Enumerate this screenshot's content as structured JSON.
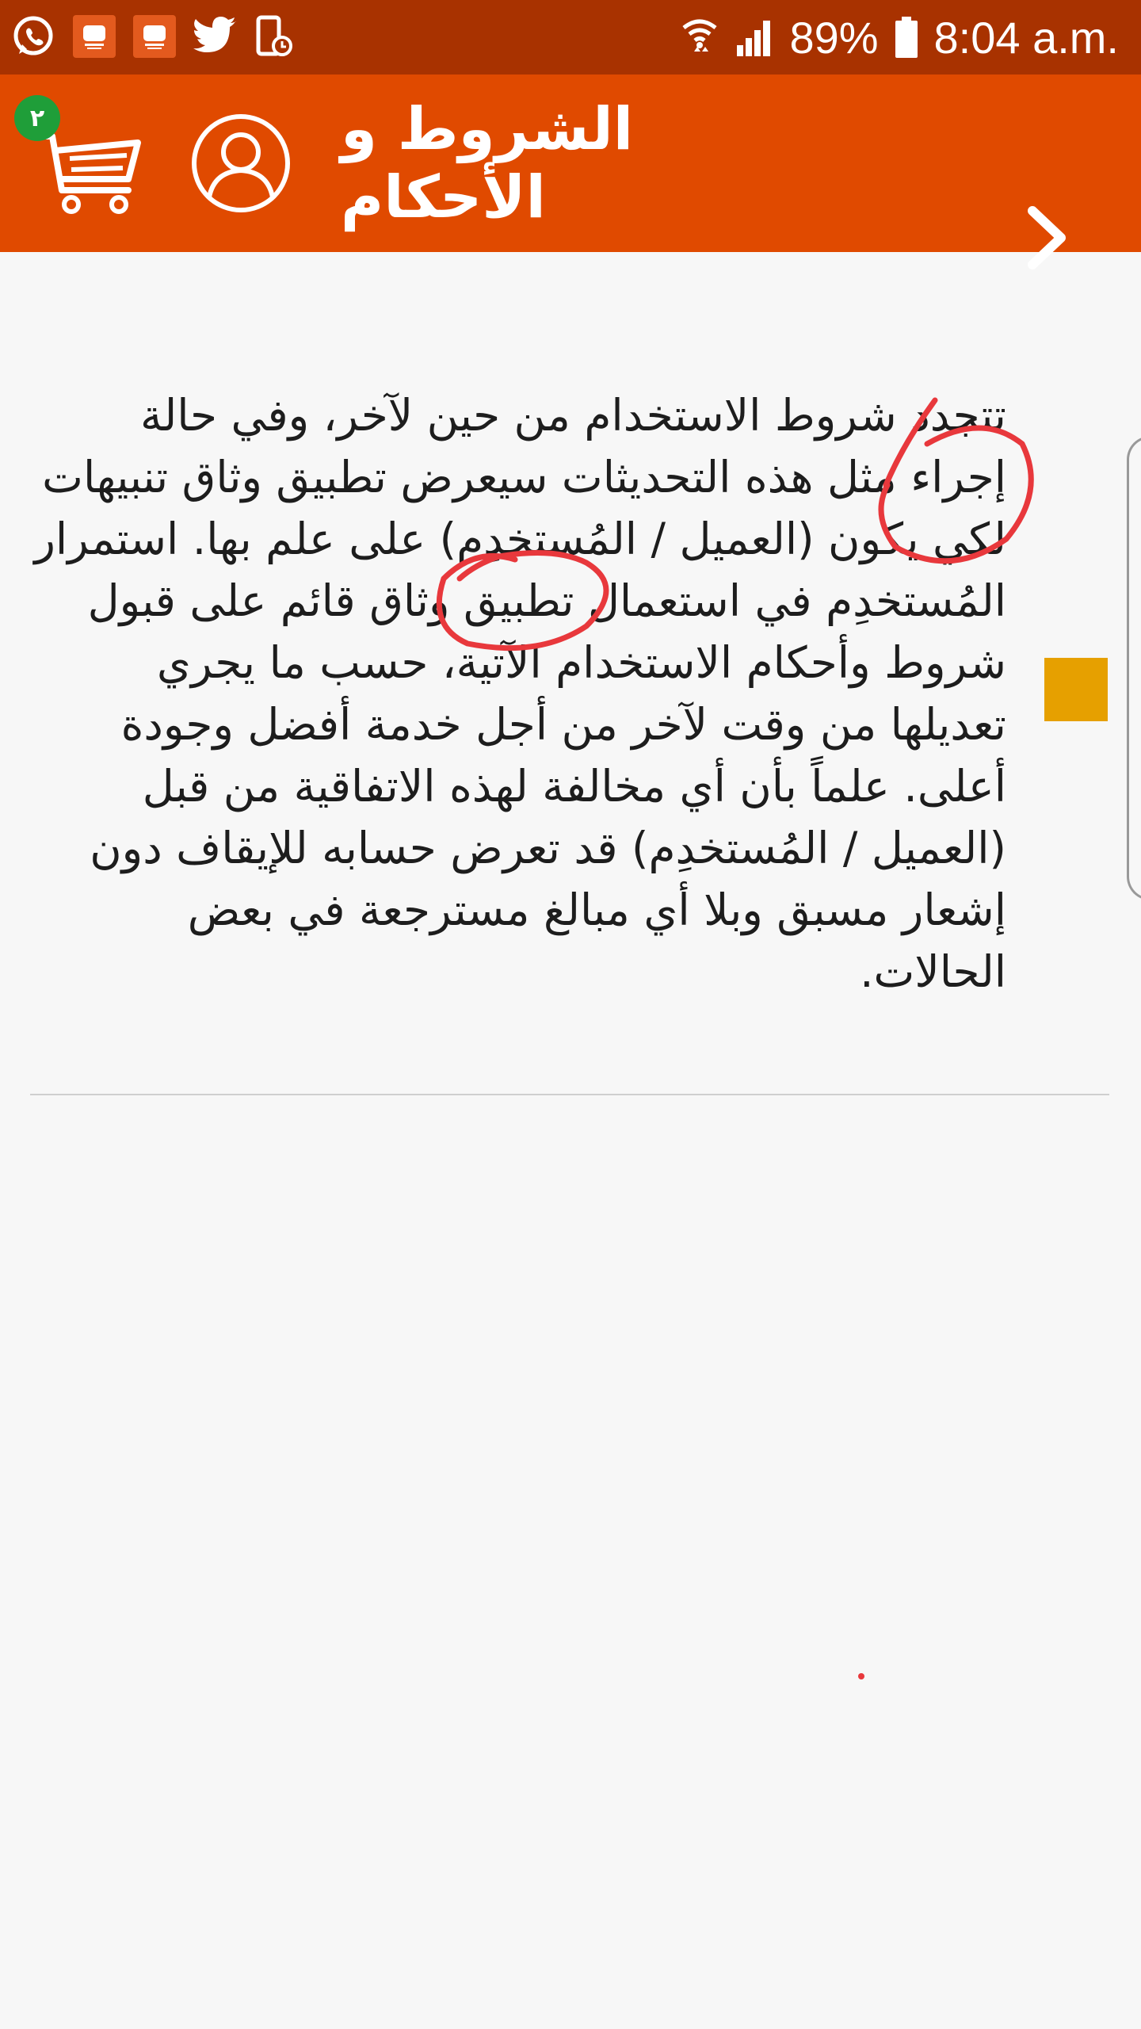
{
  "status_bar": {
    "battery": "89%",
    "time": "8:04 a.m.",
    "left_icons": [
      "whatsapp-icon",
      "app-notification-icon",
      "app-notification-icon",
      "twitter-icon",
      "device-icon"
    ],
    "right_icons": [
      "wifi-icon",
      "signal-icon",
      "battery-icon"
    ]
  },
  "app_bar": {
    "title": "الشروط و الأحكام",
    "cart_badge": "٢",
    "colors": {
      "app_bar": "#e04a00",
      "status_bar": "#a83200",
      "badge": "#1f9e39"
    }
  },
  "terms": {
    "body": "تتجدد شروط الاستخدام من حين لآخر، وفي حالة إجراء مثل هذه التحديثات سيعرض تطبيق وثاق تنبيهات لكي يكون (العميل / المُستخدِم) على علم بها. استمرار المُستخدِم في استعمال تطبيق وثاق قائم على قبول شروط وأحكام الاستخدام الآتية، حسب ما يجري تعديلها من وقت لآخر من أجل خدمة أفضل وجودة أعلى. علماً بأن أي مخالفة لهذه الاتفاقية من قبل (العميل / المُستخدِم) قد تعرض حسابه للإيقاف دون إشعار مسبق وبلا أي مبالغ مسترجعة في بعض الحالات."
  }
}
